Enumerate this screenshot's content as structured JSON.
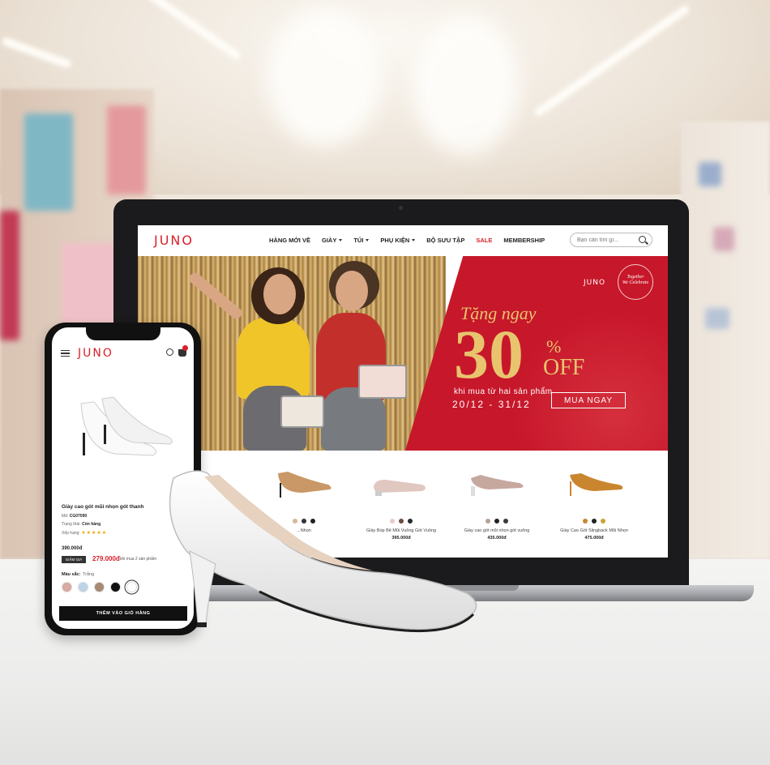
{
  "colors": {
    "brand_red": "#d7202a",
    "banner_red": "#c7172a",
    "gold": "#e8c46e"
  },
  "desktop": {
    "logo": "JUNO",
    "nav": [
      {
        "label": "HÀNG MỚI VỀ",
        "dropdown": false
      },
      {
        "label": "GIÀY",
        "dropdown": true
      },
      {
        "label": "TÚI",
        "dropdown": true
      },
      {
        "label": "PHỤ KIỆN",
        "dropdown": true
      },
      {
        "label": "BỘ SƯU TẬP",
        "dropdown": false
      },
      {
        "label": "SALE",
        "dropdown": false
      },
      {
        "label": "MEMBERSHIP",
        "dropdown": false
      }
    ],
    "search": {
      "placeholder": "Bạn cần tìm gì..."
    },
    "banner": {
      "brand": "JUNO",
      "seal_line1": "Together",
      "seal_line2": "We Celebrate",
      "headline": "Tặng ngay",
      "discount_number": "30",
      "discount_percent": "%",
      "discount_word": "OFF",
      "subline": "khi mua từ hai sản phẩm",
      "date_range": "20/12 - 31/12",
      "cta": "MUA NGAY"
    },
    "products": [
      {
        "name": "...Nhọn",
        "price": "",
        "shoe_color": "#c99866",
        "swatches": [
          "#d7b79a",
          "#333333",
          "#222222"
        ]
      },
      {
        "name": "Giày Búp Bê Mũi Vuông Gót Vuông",
        "price": "395.000đ",
        "shoe_color": "#e0c7c0",
        "swatches": [
          "#e3cfc8",
          "#6b4d3e",
          "#2a2a2a"
        ]
      },
      {
        "name": "Giày cao gót mũi nhọn gót vuông",
        "price": "435.000đ",
        "shoe_color": "#c7a89e",
        "swatches": [
          "#b9a197",
          "#222222",
          "#3a3a3a"
        ]
      },
      {
        "name": "Giày Cao Gót Slingback Mũi Nhọn",
        "price": "475.000đ",
        "shoe_color": "#c9862e",
        "swatches": [
          "#c9862e",
          "#222222",
          "#c9a23a"
        ]
      }
    ]
  },
  "mobile": {
    "logo": "JUNO",
    "cart_icon": "shopping-bag-icon",
    "product_title": "Giày cao gót mũi nhọn gót thanh",
    "sku_label": "Mã:",
    "sku_value": "CG07090",
    "status_label": "Trạng thái:",
    "status_value": "Còn hàng",
    "rating_label": "Xếp hạng:",
    "rating": "★★★★★",
    "old_price": "390.000đ",
    "tag": "GIẢM GIÁ",
    "price": "279.000đ",
    "price_note": "khi mua 2 sản phẩm",
    "color_label": "Màu sắc:",
    "color_value": "Trắng",
    "swatches": [
      "#d9a9a3",
      "#bcd4e6",
      "#a68a74",
      "#111111",
      "#ffffff"
    ],
    "selected_swatch": 4,
    "cta": "THÊM VÀO GIỎ HÀNG"
  }
}
